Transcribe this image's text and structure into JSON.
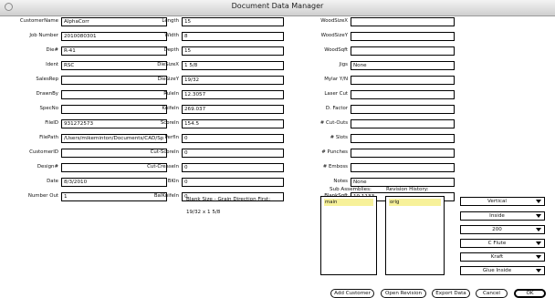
{
  "window": {
    "title": "Document Data Manager"
  },
  "col1": [
    {
      "label": "CustomerName",
      "value": "AlphaCorr"
    },
    {
      "label": "Job Number",
      "value": "2010080301"
    },
    {
      "label": "Die#",
      "value": "R-41"
    },
    {
      "label": "Ident",
      "value": "RSC"
    },
    {
      "label": "SalesRep",
      "value": ""
    },
    {
      "label": "DrawnBy",
      "value": ""
    },
    {
      "label": "SpecNo",
      "value": ""
    },
    {
      "label": "FileID",
      "value": "931272573"
    },
    {
      "label": "FilePath",
      "value": "/Users/mikeminton/Documents/CAD/Sp"
    },
    {
      "label": "CustomerID",
      "value": ""
    },
    {
      "label": "Design#",
      "value": ""
    },
    {
      "label": "Date",
      "value": "8/3/2010"
    },
    {
      "label": "Number Out",
      "value": "1"
    }
  ],
  "col2": [
    {
      "label": "Length",
      "value": "15"
    },
    {
      "label": "Width",
      "value": "8"
    },
    {
      "label": "Depth",
      "value": "15"
    },
    {
      "label": "DieSizeX",
      "value": "1 5/8"
    },
    {
      "label": "DieSizeY",
      "value": "19/32"
    },
    {
      "label": "RuleIn",
      "value": "12.3057"
    },
    {
      "label": "KnifeIn",
      "value": "269.037"
    },
    {
      "label": "ScoreIn",
      "value": "154.5"
    },
    {
      "label": "PerfIn",
      "value": "0"
    },
    {
      "label": "Cut-ScoreIn",
      "value": "0"
    },
    {
      "label": "Cut-CreaseIn",
      "value": "0"
    },
    {
      "label": "BKIn",
      "value": "0"
    },
    {
      "label": "BalKnifeIn",
      "value": "0"
    }
  ],
  "col3": [
    {
      "label": "WoodSizeX",
      "value": ""
    },
    {
      "label": "WoodSizeY",
      "value": ""
    },
    {
      "label": "WoodSqft",
      "value": ""
    },
    {
      "label": "Jigs",
      "value": "None"
    },
    {
      "label": "Mylar Y/N",
      "value": ""
    },
    {
      "label": "Laser Cut",
      "value": ""
    },
    {
      "label": "D. Factor",
      "value": ""
    },
    {
      "label": "# Cut-Outs",
      "value": ""
    },
    {
      "label": "# Slots",
      "value": ""
    },
    {
      "label": "# Punches",
      "value": ""
    },
    {
      "label": "# Emboss",
      "value": ""
    },
    {
      "label": "Notes",
      "value": "None"
    },
    {
      "label": "BlankSqft",
      "value": "10.1133"
    }
  ],
  "blank_size": {
    "title": "Blank Size - Grain Direction First:",
    "value": "19/32 x 1 5/8"
  },
  "sub_assemblies": {
    "label": "Sub Assemblies:",
    "items": [
      "main"
    ]
  },
  "revision_history": {
    "label": "Revision History:",
    "items": [
      "orig"
    ]
  },
  "dropdowns": [
    "Vertical",
    "Inside",
    "200",
    "C Flute",
    "Kraft",
    "Glue Inside"
  ],
  "buttons": {
    "add_customer": "Add Customer",
    "open_revision": "Open Revision",
    "export_data": "Export Data",
    "cancel": "Cancel",
    "ok": "OK"
  }
}
